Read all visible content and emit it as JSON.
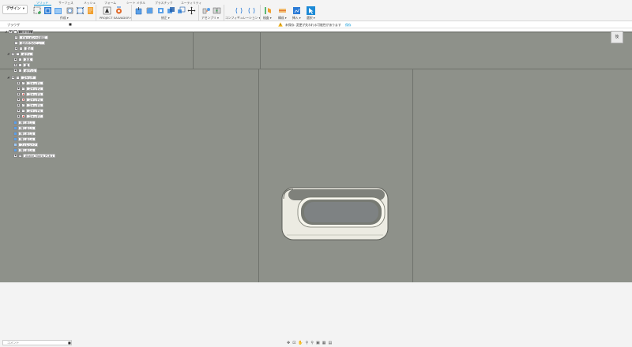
{
  "toolbar": {
    "workspace": "デザイン",
    "tabs": [
      "ソリッド",
      "サーフェス",
      "メッシュ",
      "フォーム",
      "シート メタル",
      "プラスチック",
      "ユーティリティ"
    ],
    "groups": [
      "作成 ▾",
      "PROJECT SALVADOR ▾",
      "修正 ▾",
      "アセンブリ ▾",
      "コンフィギュレーション ▾",
      "検査 ▾",
      "構成 ▾",
      "挿入 ▾",
      "選択 ▾"
    ]
  },
  "browser": {
    "title": "ブラウザ",
    "collapse": "■",
    "root": "(未保存)",
    "items": [
      "ドキュメントの設定",
      "名前付きのビュー",
      "原点",
      "ボディ",
      "本体",
      "蓋",
      "ボディ1",
      "スケッチ",
      "スケッチ1",
      "スケッチ2",
      "スケッチ3",
      "スケッチ4",
      "スケッチ5",
      "スケッチ6",
      "スケッチ7",
      "押し出し1",
      "押し出し2",
      "押し出し3",
      "押し出し4",
      "フィレット7",
      "押し出し4",
      "Akaike_Matrix_PCB:1"
    ]
  },
  "status": {
    "warning": "未保存:",
    "message": "変更が失われる可能性があります",
    "link": "保存"
  },
  "viewcube": "後",
  "comments": {
    "placeholder": "コメント",
    "close": "■"
  }
}
